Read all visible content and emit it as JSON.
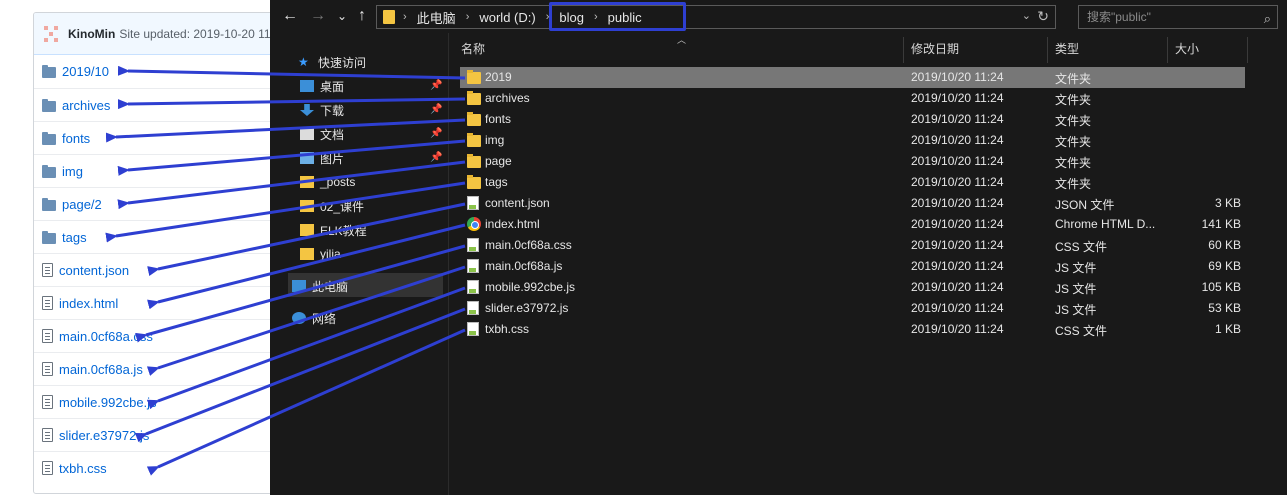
{
  "github": {
    "owner": "KinoMin",
    "updated": "Site updated: 2019-10-20 11:",
    "items": [
      {
        "name": "2019/10",
        "type": "dir"
      },
      {
        "name": "archives",
        "type": "dir"
      },
      {
        "name": "fonts",
        "type": "dir"
      },
      {
        "name": "img",
        "type": "dir"
      },
      {
        "name": "page/2",
        "type": "dir"
      },
      {
        "name": "tags",
        "type": "dir"
      },
      {
        "name": "content.json",
        "type": "file"
      },
      {
        "name": "index.html",
        "type": "file"
      },
      {
        "name": "main.0cf68a.css",
        "type": "file"
      },
      {
        "name": "main.0cf68a.js",
        "type": "file"
      },
      {
        "name": "mobile.992cbe.js",
        "type": "file"
      },
      {
        "name": "slider.e37972.js",
        "type": "file"
      },
      {
        "name": "txbh.css",
        "type": "file"
      }
    ]
  },
  "explorer": {
    "nav_buttons": {
      "back": "←",
      "forward": "→",
      "history": "⌄",
      "up": "↑"
    },
    "breadcrumb": [
      "此电脑",
      "world (D:)",
      "blog",
      "public"
    ],
    "search_placeholder": "搜索\"public\"",
    "columns": {
      "name": "名称",
      "date": "修改日期",
      "type": "类型",
      "size": "大小"
    },
    "sidebar": [
      {
        "label": "快速访问",
        "icon": "star-icon",
        "pinned": false
      },
      {
        "label": "桌面",
        "icon": "desktop-icon",
        "pinned": true
      },
      {
        "label": "下载",
        "icon": "download-icon",
        "pinned": true
      },
      {
        "label": "文档",
        "icon": "document-icon",
        "pinned": true
      },
      {
        "label": "图片",
        "icon": "picture-icon",
        "pinned": true
      },
      {
        "label": "_posts",
        "icon": "folder-icon",
        "pinned": false
      },
      {
        "label": "02_课件",
        "icon": "folder-icon",
        "pinned": false
      },
      {
        "label": "ELK教程",
        "icon": "folder-icon",
        "pinned": false
      },
      {
        "label": "yilia",
        "icon": "folder-icon",
        "pinned": false
      },
      {
        "label": "此电脑",
        "icon": "computer-icon",
        "pinned": false
      },
      {
        "label": "网络",
        "icon": "network-icon",
        "pinned": false
      }
    ],
    "files": [
      {
        "name": "2019",
        "date": "2019/10/20 11:24",
        "type": "文件夹",
        "size": "",
        "icon": "folder"
      },
      {
        "name": "archives",
        "date": "2019/10/20 11:24",
        "type": "文件夹",
        "size": "",
        "icon": "folder"
      },
      {
        "name": "fonts",
        "date": "2019/10/20 11:24",
        "type": "文件夹",
        "size": "",
        "icon": "folder"
      },
      {
        "name": "img",
        "date": "2019/10/20 11:24",
        "type": "文件夹",
        "size": "",
        "icon": "folder"
      },
      {
        "name": "page",
        "date": "2019/10/20 11:24",
        "type": "文件夹",
        "size": "",
        "icon": "folder"
      },
      {
        "name": "tags",
        "date": "2019/10/20 11:24",
        "type": "文件夹",
        "size": "",
        "icon": "folder"
      },
      {
        "name": "content.json",
        "date": "2019/10/20 11:24",
        "type": "JSON 文件",
        "size": "3 KB",
        "icon": "doc"
      },
      {
        "name": "index.html",
        "date": "2019/10/20 11:24",
        "type": "Chrome HTML D...",
        "size": "141 KB",
        "icon": "chrome"
      },
      {
        "name": "main.0cf68a.css",
        "date": "2019/10/20 11:24",
        "type": "CSS 文件",
        "size": "60 KB",
        "icon": "doc"
      },
      {
        "name": "main.0cf68a.js",
        "date": "2019/10/20 11:24",
        "type": "JS 文件",
        "size": "69 KB",
        "icon": "doc"
      },
      {
        "name": "mobile.992cbe.js",
        "date": "2019/10/20 11:24",
        "type": "JS 文件",
        "size": "105 KB",
        "icon": "doc"
      },
      {
        "name": "slider.e37972.js",
        "date": "2019/10/20 11:24",
        "type": "JS 文件",
        "size": "53 KB",
        "icon": "doc"
      },
      {
        "name": "txbh.css",
        "date": "2019/10/20 11:24",
        "type": "CSS 文件",
        "size": "1 KB",
        "icon": "doc"
      }
    ],
    "selected_index": 0
  },
  "colors": {
    "annotation": "#2e3fd1",
    "explorer_bg": "#191919",
    "link": "#0366d6"
  }
}
